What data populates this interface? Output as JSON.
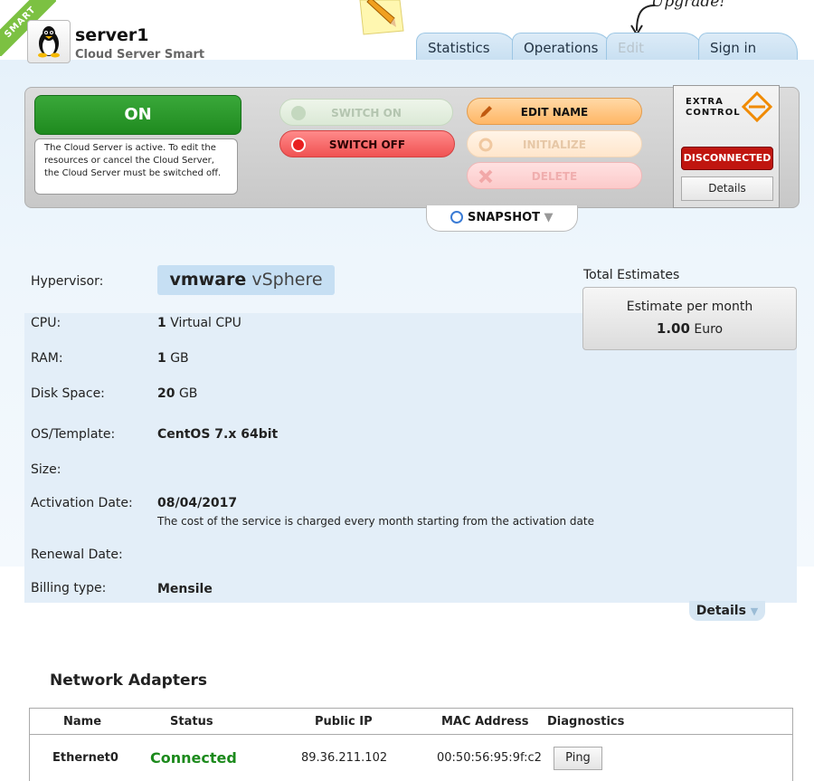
{
  "header": {
    "smart_ribbon": "SMART",
    "server_name": "server1",
    "server_type": "Cloud Server Smart",
    "upgrade_note": "Upgrade!",
    "tabs": [
      {
        "label": "Statistics"
      },
      {
        "label": "Operations"
      },
      {
        "label": "Edit"
      },
      {
        "label": "Sign in"
      }
    ]
  },
  "control": {
    "power_state": "ON",
    "status_message": "The Cloud Server is active. To edit the resources or cancel the Cloud Server, the Cloud Server must be switched off.",
    "switch_on": "SWITCH ON",
    "switch_off": "SWITCH OFF",
    "edit_name": "EDIT NAME",
    "initialize": "INITIALIZE",
    "delete": "DELETE",
    "extra_control_line1": "EXTRA",
    "extra_control_line2": "CONTROL",
    "connection_status": "DISCONNECTED",
    "details": "Details",
    "snapshot": "SNAPSHOT"
  },
  "info": {
    "hypervisor_label": "Hypervisor:",
    "hypervisor_brand": "vmware",
    "hypervisor_product": "vSphere",
    "cpu_label": "CPU:",
    "cpu_count": "1",
    "cpu_unit": "Virtual CPU",
    "ram_label": "RAM:",
    "ram_value": "1",
    "ram_unit": "GB",
    "disk_label": "Disk Space:",
    "disk_value": "20",
    "disk_unit": "GB",
    "os_label": "OS/Template:",
    "os_value": "CentOS 7.x 64bit",
    "size_label": "Size:",
    "activation_label": "Activation Date:",
    "activation_value": "08/04/2017",
    "activation_note": "The cost of the service is charged every month starting from the activation date",
    "renewal_label": "Renewal Date:",
    "billing_label": "Billing type:",
    "billing_value": "Mensile",
    "details_link": "Details"
  },
  "estimates": {
    "title": "Total Estimates",
    "per_month_label": "Estimate per month",
    "amount": "1.00",
    "currency": "Euro"
  },
  "network": {
    "title": "Network Adapters",
    "columns": [
      "Name",
      "Status",
      "Public IP",
      "MAC Address",
      "Diagnostics"
    ],
    "rows": [
      {
        "name": "Ethernet0",
        "status": "Connected",
        "public_ip": "89.36.211.102",
        "mac": "00:50:56:95:9f:c2",
        "action": "Ping"
      }
    ]
  },
  "colors": {
    "on_green": "#1f8a1f",
    "off_red": "#f05252",
    "disconnected_red": "#c0150f",
    "connected_green": "#1c8a1c",
    "panel_blue": "#e3eef8",
    "tab_blue": "#c9e0f2"
  },
  "icons": [
    "linux-penguin-icon",
    "pencil-icon",
    "play-icon",
    "stop-icon",
    "edit-pencil-icon",
    "refresh-icon",
    "x-icon",
    "extra-control-logo-icon",
    "clock-icon",
    "chevron-down-icon",
    "arrow-icon"
  ]
}
